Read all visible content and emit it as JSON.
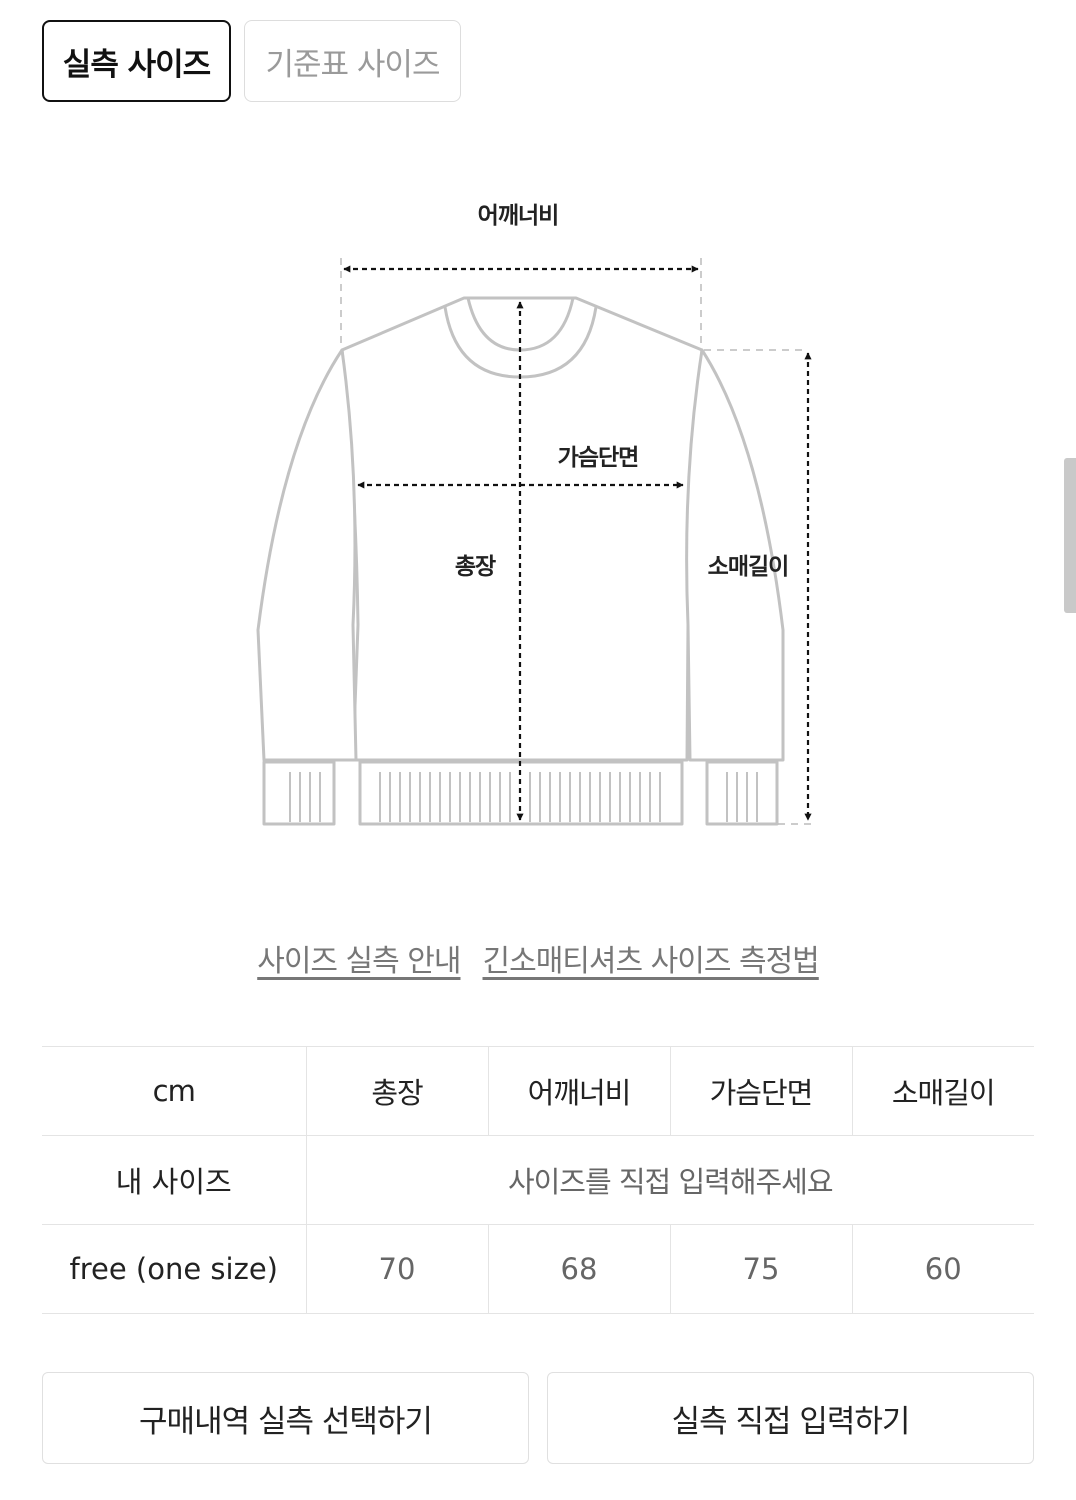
{
  "tabs": {
    "actual_label": "실측 사이즈",
    "standard_label": "기준표 사이즈"
  },
  "diagram": {
    "shoulder_label": "어깨너비",
    "chest_label": "가슴단면",
    "length_label": "총장",
    "sleeve_label": "소매길이"
  },
  "links": {
    "guide_label": "사이즈 실측 안내",
    "measure_label": "긴소매티셔츠 사이즈 측정법"
  },
  "table": {
    "unit": "cm",
    "columns": [
      "총장",
      "어깨너비",
      "가슴단면",
      "소매길이"
    ],
    "my_size_label": "내 사이즈",
    "my_size_prompt": "사이즈를 직접 입력해주세요",
    "rows": [
      {
        "size": "free (one size)",
        "values": [
          "70",
          "68",
          "75",
          "60"
        ]
      }
    ]
  },
  "buttons": {
    "history_label": "구매내역 실측 선택하기",
    "manual_label": "실측 직접 입력하기"
  },
  "colors": {
    "accent_border": "#111111",
    "muted_text": "#9a9a9a",
    "divider": "#e4e4e4"
  }
}
